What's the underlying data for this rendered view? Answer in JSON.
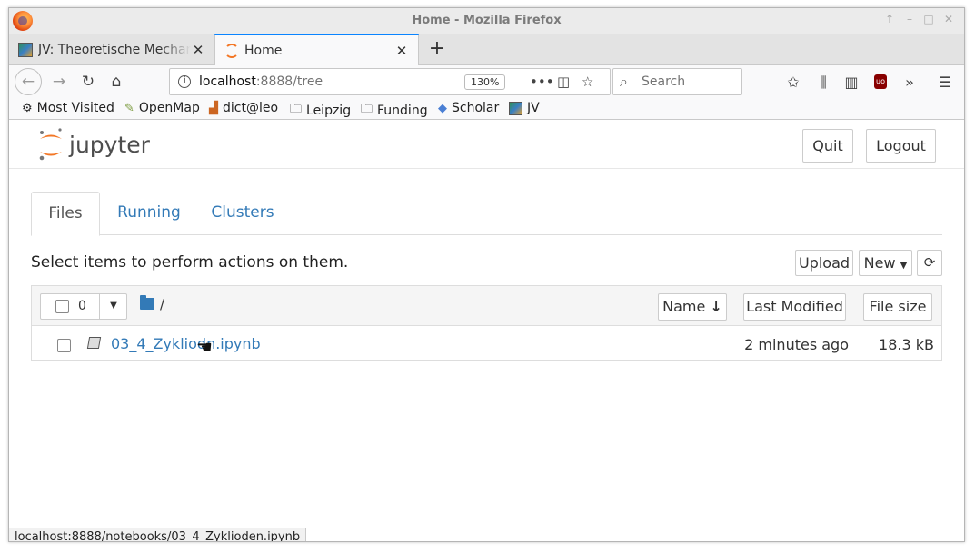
{
  "window": {
    "title": "Home - Mozilla Firefox"
  },
  "tabs": [
    {
      "label": "JV: Theoretische Mechanik",
      "active": false
    },
    {
      "label": "Home",
      "active": true
    }
  ],
  "nav": {
    "url_host": "localhost",
    "url_rest": ":8888/tree",
    "zoom": "130%",
    "search_placeholder": "Search"
  },
  "bookmarks": [
    {
      "label": "Most Visited",
      "icon": "gear-icon"
    },
    {
      "label": "OpenMap",
      "icon": "map-icon"
    },
    {
      "label": "dict@leo",
      "icon": "leo-icon"
    },
    {
      "label": "Leipzig",
      "icon": "folder-icon"
    },
    {
      "label": "Funding",
      "icon": "folder-icon"
    },
    {
      "label": "Scholar",
      "icon": "scholar-icon"
    },
    {
      "label": "JV",
      "icon": "jv-icon"
    }
  ],
  "jupyter": {
    "logo_text": "jupyter",
    "quit_label": "Quit",
    "logout_label": "Logout",
    "tabs": [
      "Files",
      "Running",
      "Clusters"
    ],
    "hint": "Select items to perform actions on them.",
    "upload_label": "Upload",
    "new_label": "New",
    "selected_count": "0",
    "breadcrumb": "/",
    "columns": {
      "name": "Name",
      "last_modified": "Last Modified",
      "file_size": "File size"
    },
    "files": [
      {
        "name": "03_4_Zykliodn.ipynb",
        "modified": "2 minutes ago",
        "size": "18.3 kB"
      }
    ]
  },
  "status": {
    "text": "localhost:8888/notebooks/03_4_Zyklioden.ipynb"
  },
  "colors": {
    "jupyter_orange": "#f37726",
    "link_blue": "#337ab7",
    "tab_accent": "#0a84ff"
  }
}
